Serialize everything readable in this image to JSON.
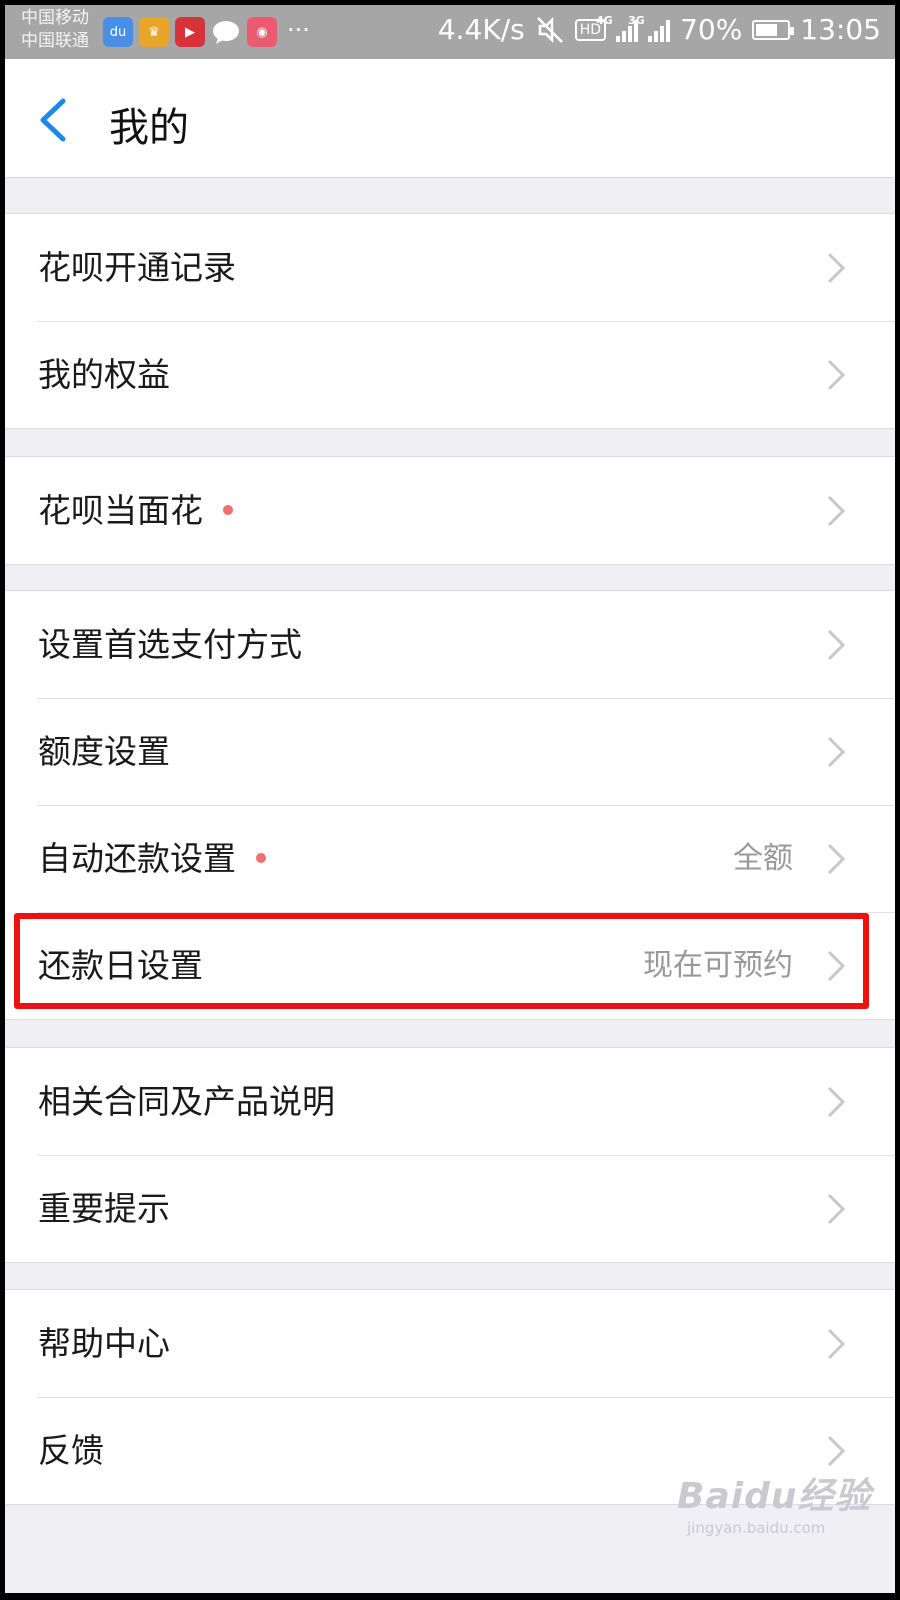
{
  "status_bar": {
    "carrier_1": "中国移动",
    "carrier_2": "中国联通",
    "apps": [
      {
        "icon": "baidu-icon",
        "color": "#4a8fe6",
        "glyph": "du"
      },
      {
        "icon": "crown-app-icon",
        "color": "#e7a629",
        "glyph": "♛"
      },
      {
        "icon": "video-app-icon",
        "color": "#d8323a",
        "glyph": "▶"
      },
      {
        "icon": "wechat-icon",
        "color": "#ffffff",
        "glyph": ""
      },
      {
        "icon": "shop-app-icon",
        "color": "#ec5a6f",
        "glyph": "◉"
      }
    ],
    "more": "···",
    "speed": "4.4K/s",
    "hd": "HD",
    "net1": "4G",
    "net2": "3G",
    "battery": "70%",
    "battery_level": 0.7,
    "time": "13:05"
  },
  "nav": {
    "title": "我的"
  },
  "groups": [
    {
      "items": [
        {
          "label": "花呗开通记录"
        },
        {
          "label": "我的权益"
        }
      ]
    },
    {
      "items": [
        {
          "label": "花呗当面花",
          "dot": true
        }
      ]
    },
    {
      "items": [
        {
          "label": "设置首选支付方式"
        },
        {
          "label": "额度设置"
        },
        {
          "label": "自动还款设置",
          "dot": true,
          "value": "全额"
        },
        {
          "label": "还款日设置",
          "value": "现在可预约"
        }
      ]
    },
    {
      "items": [
        {
          "label": "相关合同及产品说明"
        },
        {
          "label": "重要提示"
        }
      ]
    },
    {
      "items": [
        {
          "label": "帮助中心"
        },
        {
          "label": "反馈"
        }
      ]
    }
  ],
  "colors": {
    "accent_blue": "#1e88e5",
    "highlight_red": "#ee1111",
    "dot_red": "#ee6e73"
  },
  "watermark": {
    "main": "Baidu经验",
    "sub": "jingyan.baidu.com"
  }
}
